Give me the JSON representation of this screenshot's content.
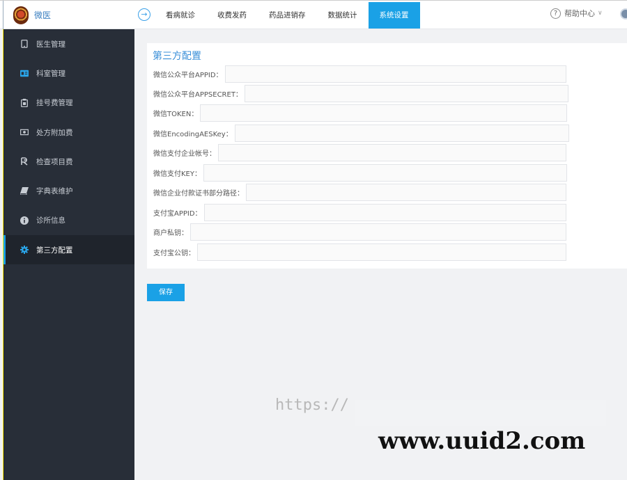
{
  "app": {
    "name": "微医"
  },
  "nav": {
    "items": [
      "看病就诊",
      "收费发药",
      "药品进销存",
      "数据统计",
      "系统设置"
    ],
    "active_index": 4,
    "help": "帮助中心"
  },
  "sidebar": {
    "items": [
      {
        "label": "医生管理",
        "icon": "phone-icon"
      },
      {
        "label": "科室管理",
        "icon": "id-card-icon"
      },
      {
        "label": "挂号费管理",
        "icon": "clipboard-icon"
      },
      {
        "label": "处方附加费",
        "icon": "money-icon"
      },
      {
        "label": "检查项目费",
        "icon": "currency-icon"
      },
      {
        "label": "字典表维护",
        "icon": "book-icon"
      },
      {
        "label": "诊所信息",
        "icon": "info-icon"
      },
      {
        "label": "第三方配置",
        "icon": "gear-icon"
      }
    ],
    "active_index": 7
  },
  "config": {
    "title": "第三方配置",
    "fields": [
      {
        "label": "微信公众平台APPID：",
        "value": ""
      },
      {
        "label": "微信公众平台APPSECRET：",
        "value": ""
      },
      {
        "label": "微信TOKEN：",
        "value": ""
      },
      {
        "label": "微信EncodingAESKey：",
        "value": ""
      },
      {
        "label": "微信支付企业帐号：",
        "value": ""
      },
      {
        "label": "微信支付KEY：",
        "value": ""
      },
      {
        "label": "微信企业付款证书部分路径：",
        "value": ""
      },
      {
        "label": "支付宝APPID：",
        "value": ""
      },
      {
        "label": "商户私钥：",
        "value": ""
      },
      {
        "label": "支付宝公钥：",
        "value": ""
      }
    ],
    "save_label": "保存"
  },
  "watermarks": [
    "https://",
    "www.uuid2.com"
  ],
  "colors": {
    "accent": "#1aa1e6",
    "sidebar_bg": "#282e38",
    "title": "#3a8fd8"
  }
}
